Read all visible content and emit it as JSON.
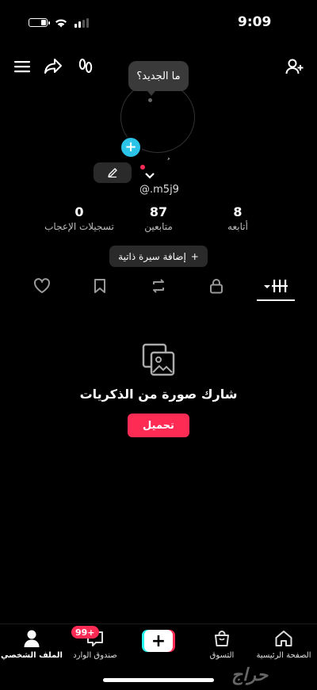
{
  "status_bar": {
    "time": "9:09"
  },
  "header": {
    "menu_icon": "hamburger-icon",
    "share_icon": "share-icon",
    "footprints_icon": "footprints-icon",
    "add_friend_icon": "add-user-icon"
  },
  "profile": {
    "bubble_text": "ما الجديد؟",
    "name_mark": "ُ",
    "username": "@.m5j9"
  },
  "stats": [
    {
      "value": "8",
      "label": "أتابعه"
    },
    {
      "value": "87",
      "label": "متابعين"
    },
    {
      "value": "0",
      "label": "تسجيلات الإعجاب"
    }
  ],
  "bio_button": {
    "label": "إضافة سيرة ذاتية",
    "icon": "+"
  },
  "empty_state": {
    "text": "شارك صورة من الذكريات",
    "button": "تحميل"
  },
  "bottom_nav": {
    "home": "الصفحة الرئيسية",
    "shop": "التسوق",
    "inbox": "صندوق الوارد",
    "inbox_badge": "99+",
    "profile": "الملف الشخصي"
  },
  "watermark": "حراج",
  "colors": {
    "accent": "#fe2c55",
    "cyan": "#25f4ee",
    "plus_badge": "#2bc4e8"
  }
}
